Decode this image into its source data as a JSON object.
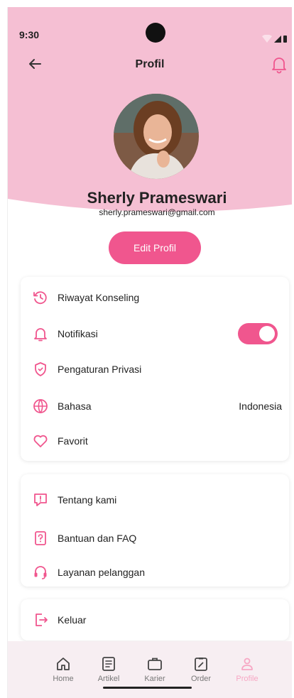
{
  "status_bar": {
    "time": "9:30"
  },
  "header": {
    "title": "Profil",
    "back_icon": "arrow-left-icon",
    "bell_icon": "bell-icon"
  },
  "profile": {
    "name": "Sherly Prameswari",
    "email": "sherly.prameswari@gmail.com",
    "edit_label": "Edit Profil"
  },
  "menu_main": {
    "items": [
      {
        "label": "Riwayat Konseling",
        "icon": "history-icon"
      },
      {
        "label": "Notifikasi",
        "icon": "bell-icon",
        "toggle_on": true
      },
      {
        "label": "Pengaturan Privasi",
        "icon": "shield-icon"
      },
      {
        "label": "Bahasa",
        "icon": "globe-icon",
        "value": "Indonesia"
      },
      {
        "label": "Favorit",
        "icon": "heart-icon"
      }
    ]
  },
  "menu_info": {
    "items": [
      {
        "label": "Tentang kami",
        "icon": "info-alert-icon"
      },
      {
        "label": "Bantuan dan FAQ",
        "icon": "question-icon"
      },
      {
        "label": "Layanan pelanggan",
        "icon": "headset-icon"
      }
    ]
  },
  "menu_logout": {
    "label": "Keluar",
    "icon": "logout-icon"
  },
  "bottom_nav": {
    "items": [
      {
        "label": "Home",
        "icon": "home-icon"
      },
      {
        "label": "Artikel",
        "icon": "article-icon"
      },
      {
        "label": "Karier",
        "icon": "briefcase-icon"
      },
      {
        "label": "Order",
        "icon": "order-icon"
      },
      {
        "label": "Profile",
        "icon": "user-icon",
        "active": true
      }
    ]
  },
  "colors": {
    "header_bg": "#f5bfd3",
    "accent": "#f0568e",
    "nav_bg": "#f7eef2",
    "active_nav": "#f7a7c4"
  }
}
